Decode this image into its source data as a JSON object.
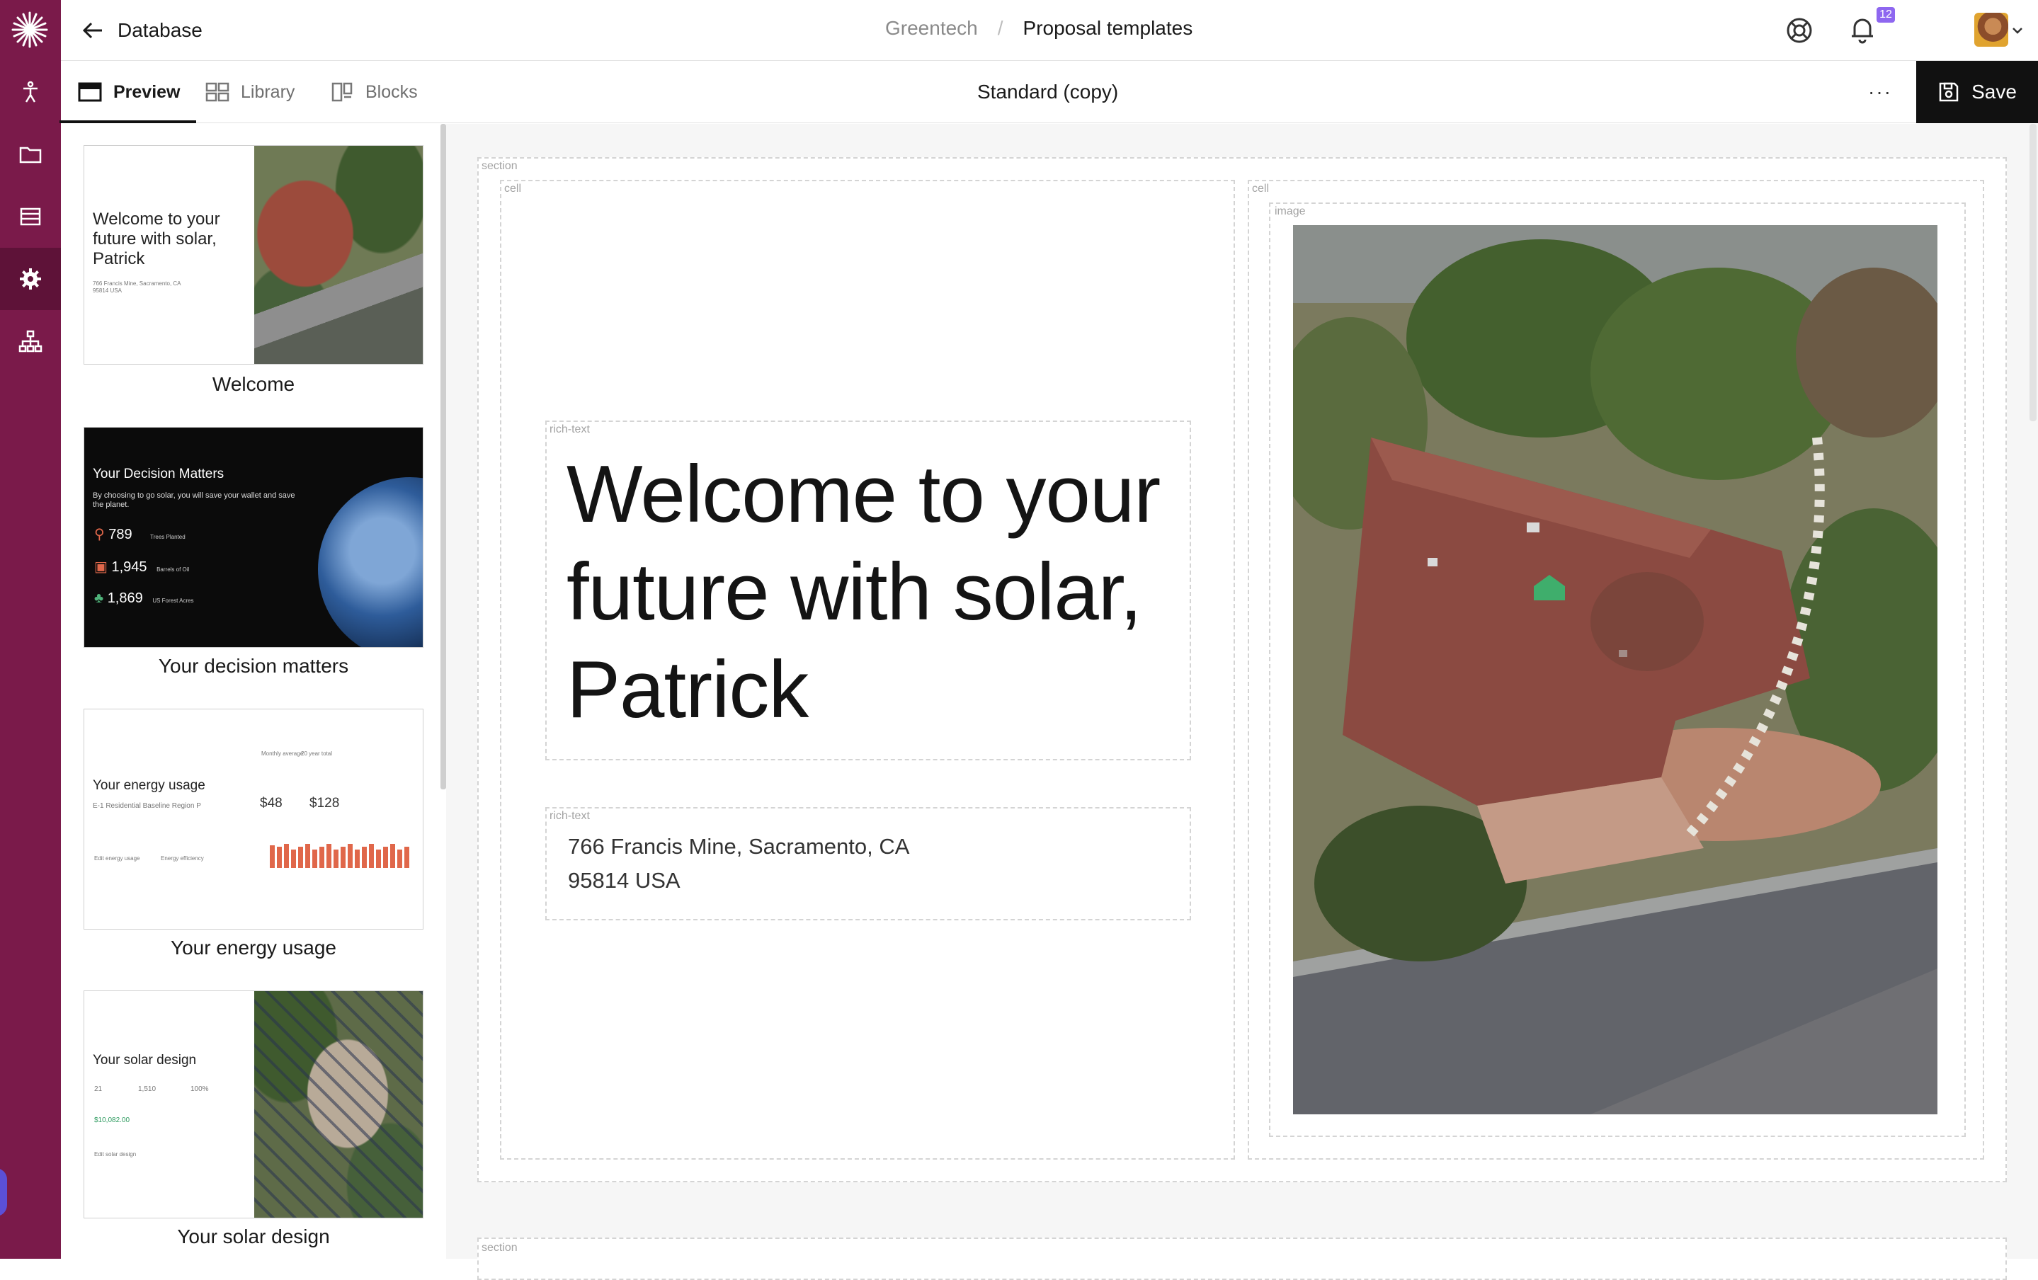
{
  "rail": {
    "items": [
      {
        "name": "rail-accessibility-icon"
      },
      {
        "name": "rail-folder-icon"
      },
      {
        "name": "rail-database-icon"
      },
      {
        "name": "rail-settings-icon"
      },
      {
        "name": "rail-org-chart-icon"
      }
    ],
    "active_index": 3
  },
  "topbar": {
    "back_label": "Database",
    "breadcrumb_parent": "Greentech",
    "breadcrumb_separator": "/",
    "breadcrumb_current": "Proposal templates",
    "notification_count": "12"
  },
  "toolbar": {
    "tabs": [
      {
        "label": "Preview",
        "active": true
      },
      {
        "label": "Library",
        "active": false
      },
      {
        "label": "Blocks",
        "active": false
      }
    ],
    "document_title": "Standard (copy)",
    "more_label": "···",
    "save_label": "Save"
  },
  "thumbnails": [
    {
      "label": "Welcome",
      "title": "Welcome to your future with solar, Patrick",
      "address": "766 Francis Mine, Sacramento, CA 95814 USA"
    },
    {
      "label": "Your decision matters",
      "title": "Your Decision Matters",
      "subtitle": "By choosing to go solar, you will save your wallet and save the planet.",
      "stats": [
        {
          "value": "789",
          "name": "Trees Planted"
        },
        {
          "value": "1,945",
          "name": "Barrels of Oil"
        },
        {
          "value": "1,869",
          "name": "US Forest Acres"
        }
      ]
    },
    {
      "label": "Your energy usage",
      "title": "Your energy usage",
      "utility": "E-1 Residential Baseline Region P",
      "today": "$48",
      "with_solar": "$128",
      "tab_a": "Monthly average",
      "tab_b": "20 year total",
      "edit_label": "Edit energy usage",
      "efficiency_label": "Energy efficiency"
    },
    {
      "label": "Your solar design",
      "title": "Your solar design",
      "panels": "21",
      "production": "1,510",
      "offset": "100%",
      "savings": "$10,082.00",
      "edit_label": "Edit solar design"
    }
  ],
  "canvas": {
    "section_tag": "section",
    "cell_tag": "cell",
    "image_tag": "image",
    "rich_text_tag": "rich-text",
    "headline": "Welcome to your future with solar, Patrick",
    "address_line1": "766 Francis Mine, Sacramento, CA",
    "address_line2": "95814 USA"
  },
  "colors": {
    "rail": "#7a1a4a",
    "rail_active": "#5e1238",
    "save_button": "#111111",
    "badge": "#8e67f0",
    "chart_bar": "#e0674a"
  }
}
